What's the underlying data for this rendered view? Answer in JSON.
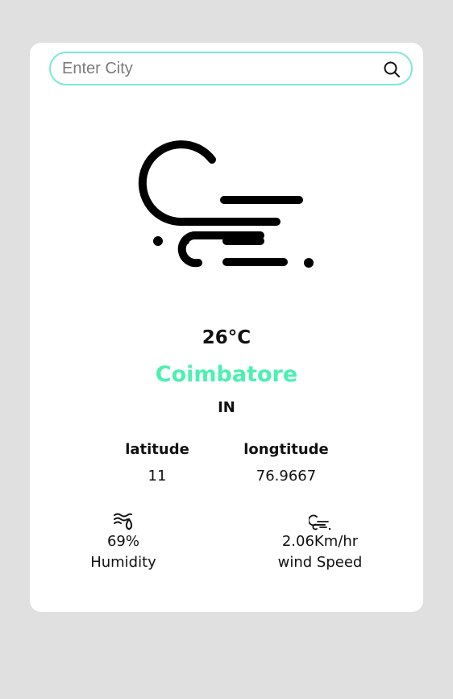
{
  "search": {
    "placeholder": "Enter City",
    "value": "",
    "button_icon": "search-icon"
  },
  "weather": {
    "icon": "wind-cloud-icon",
    "temperature": "26°C",
    "city": "Coimbatore",
    "country": "IN"
  },
  "coordinates": {
    "latitude_label": "latitude",
    "latitude_value": "11",
    "longitude_label": "longtitude",
    "longitude_value": "76.9667"
  },
  "humidity": {
    "icon": "humidity-icon",
    "value": "69%",
    "label": "Humidity"
  },
  "wind": {
    "icon": "wind-icon",
    "value": "2.06Km/hr",
    "label": "wind Speed"
  },
  "colors": {
    "page_bg": "#e0e0e0",
    "card_bg": "#ffffff",
    "accent": "#4cf0b0",
    "search_border": "#7de9d5"
  }
}
